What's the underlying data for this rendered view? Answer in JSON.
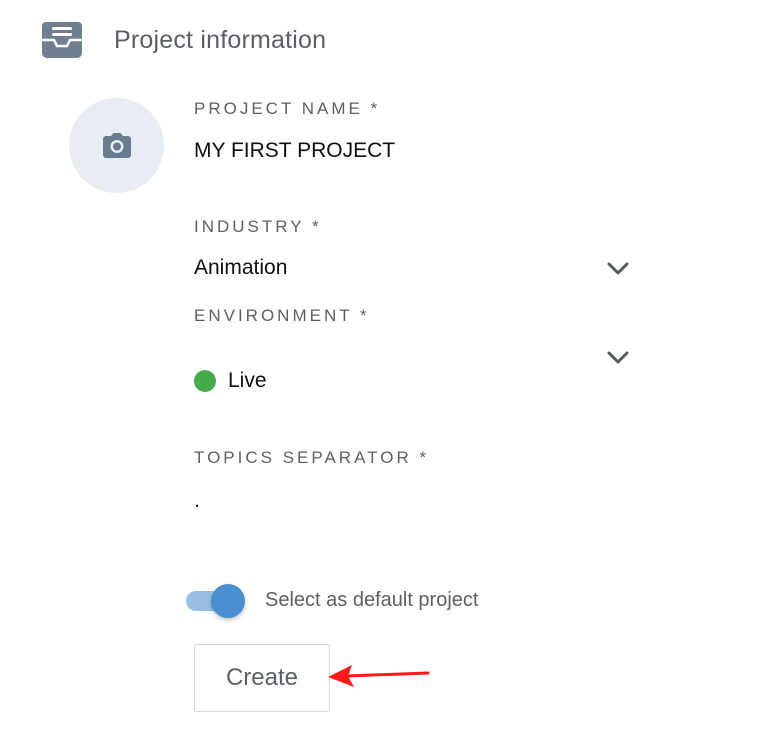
{
  "header": {
    "title": "Project information",
    "icon": "inbox-icon"
  },
  "avatar": {
    "icon": "camera-icon"
  },
  "form": {
    "project_name": {
      "label": "PROJECT NAME *",
      "value": "MY FIRST PROJECT"
    },
    "industry": {
      "label": "INDUSTRY *",
      "value": "Animation"
    },
    "environment": {
      "label": "ENVIRONMENT *",
      "value": "Live",
      "status_color": "#46a94a"
    },
    "topics_separator": {
      "label": "TOPICS SEPARATOR *",
      "value": "."
    }
  },
  "default_toggle": {
    "label": "Select as default project",
    "on": true,
    "color": "#4a8fd0"
  },
  "create_button": {
    "label": "Create"
  },
  "annotation": {
    "arrow_color": "#ff1a1a"
  }
}
